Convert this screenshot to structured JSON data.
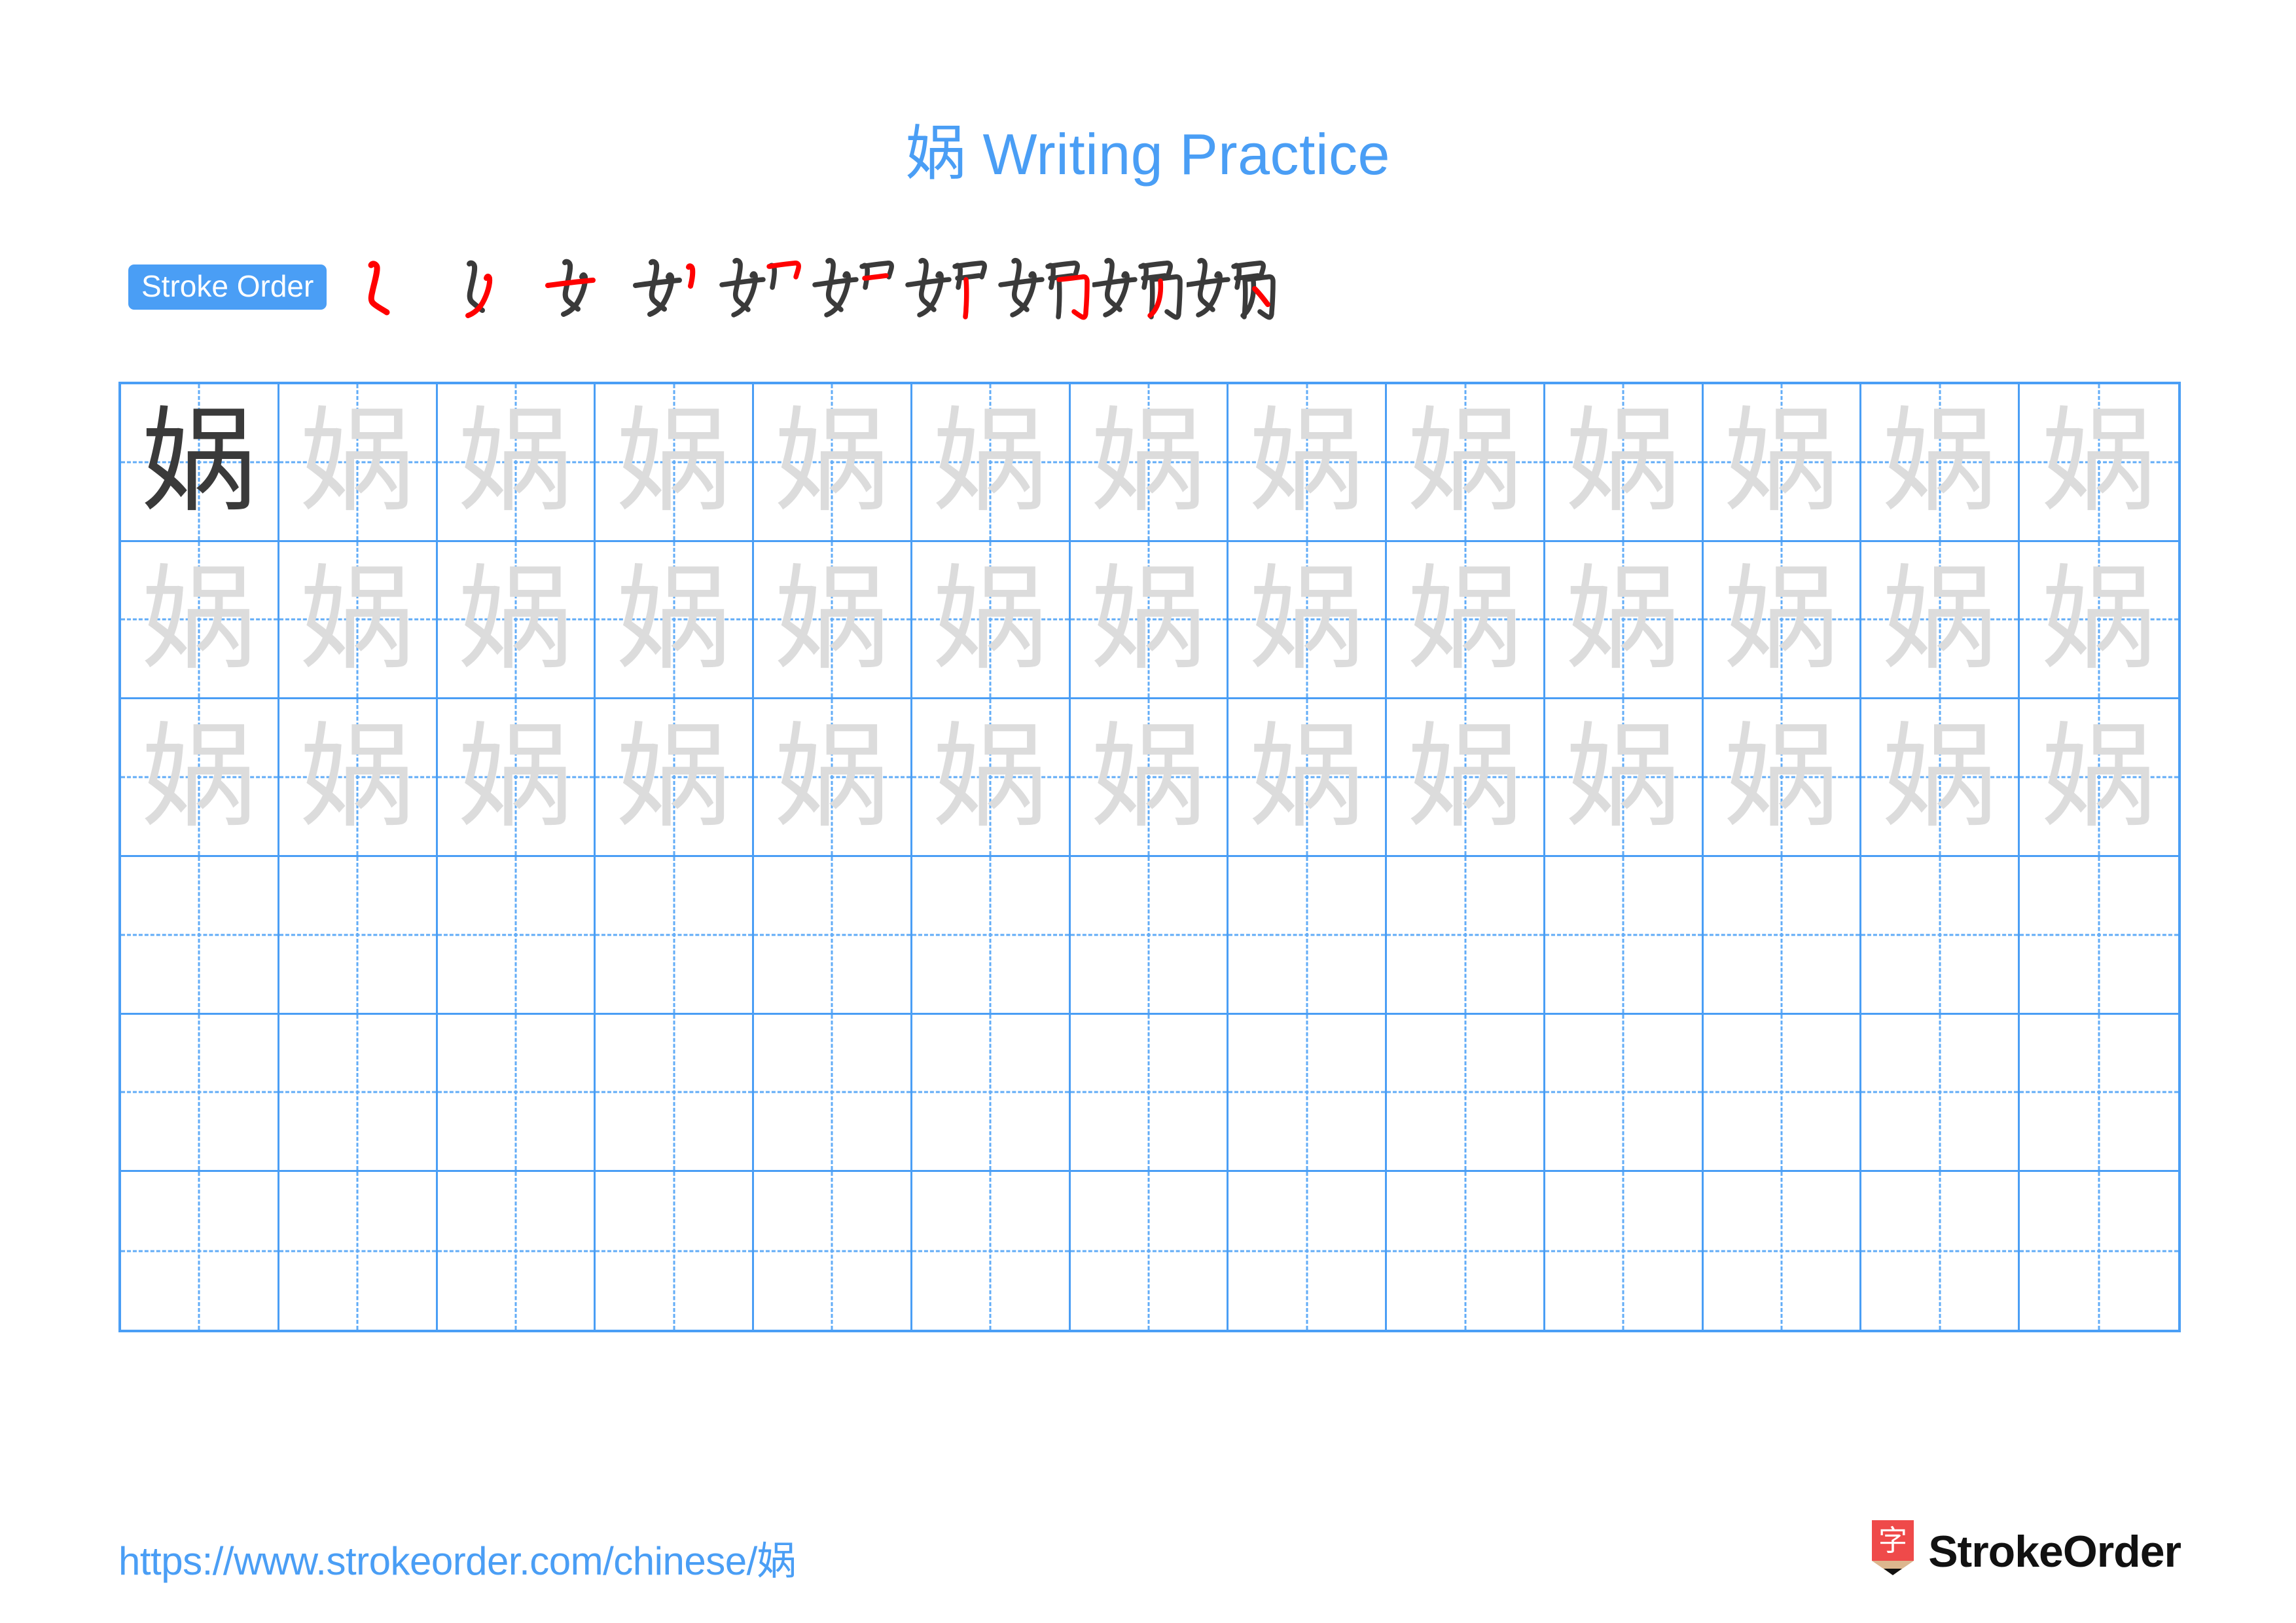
{
  "page": {
    "character": "娲",
    "title_suffix": " Writing Practice",
    "title_full": "娲 Writing Practice",
    "background_color": "#ffffff"
  },
  "colors": {
    "accent_blue": "#4a9ef5",
    "grid_line_blue": "#4a9ef5",
    "grid_dash_blue": "#62acf7",
    "model_char_gray": "#3a3a3a",
    "trace_char_gray": "#dcdcdc",
    "stroke_new_red": "#ff0000",
    "stroke_old_gray": "#3a3a3a",
    "logo_red": "#ef4a4a",
    "logo_wood": "#dcb68e",
    "brand_black": "#111111"
  },
  "stroke_order": {
    "label": "Stroke Order",
    "total_strokes": 10,
    "steps": [
      {
        "index": 1,
        "name": "stroke-step-1",
        "new_stroke": "撇点"
      },
      {
        "index": 2,
        "name": "stroke-step-2",
        "new_stroke": "撇"
      },
      {
        "index": 3,
        "name": "stroke-step-3",
        "new_stroke": "横"
      },
      {
        "index": 4,
        "name": "stroke-step-4",
        "new_stroke": "竖"
      },
      {
        "index": 5,
        "name": "stroke-step-5",
        "new_stroke": "横折"
      },
      {
        "index": 6,
        "name": "stroke-step-6",
        "new_stroke": "横"
      },
      {
        "index": 7,
        "name": "stroke-step-7",
        "new_stroke": "竖"
      },
      {
        "index": 8,
        "name": "stroke-step-8",
        "new_stroke": "横折钩"
      },
      {
        "index": 9,
        "name": "stroke-step-9",
        "new_stroke": "撇"
      },
      {
        "index": 10,
        "name": "stroke-step-10",
        "new_stroke": "点"
      }
    ]
  },
  "grid": {
    "columns": 13,
    "rows": 6,
    "filled_rows": 3,
    "empty_rows": 3,
    "model_cell": {
      "row": 1,
      "column": 1
    },
    "cell_character": "娲"
  },
  "footer": {
    "url": "https://www.strokeorder.com/chinese/娲",
    "brand_name": "StrokeOrder",
    "logo_character": "字"
  }
}
